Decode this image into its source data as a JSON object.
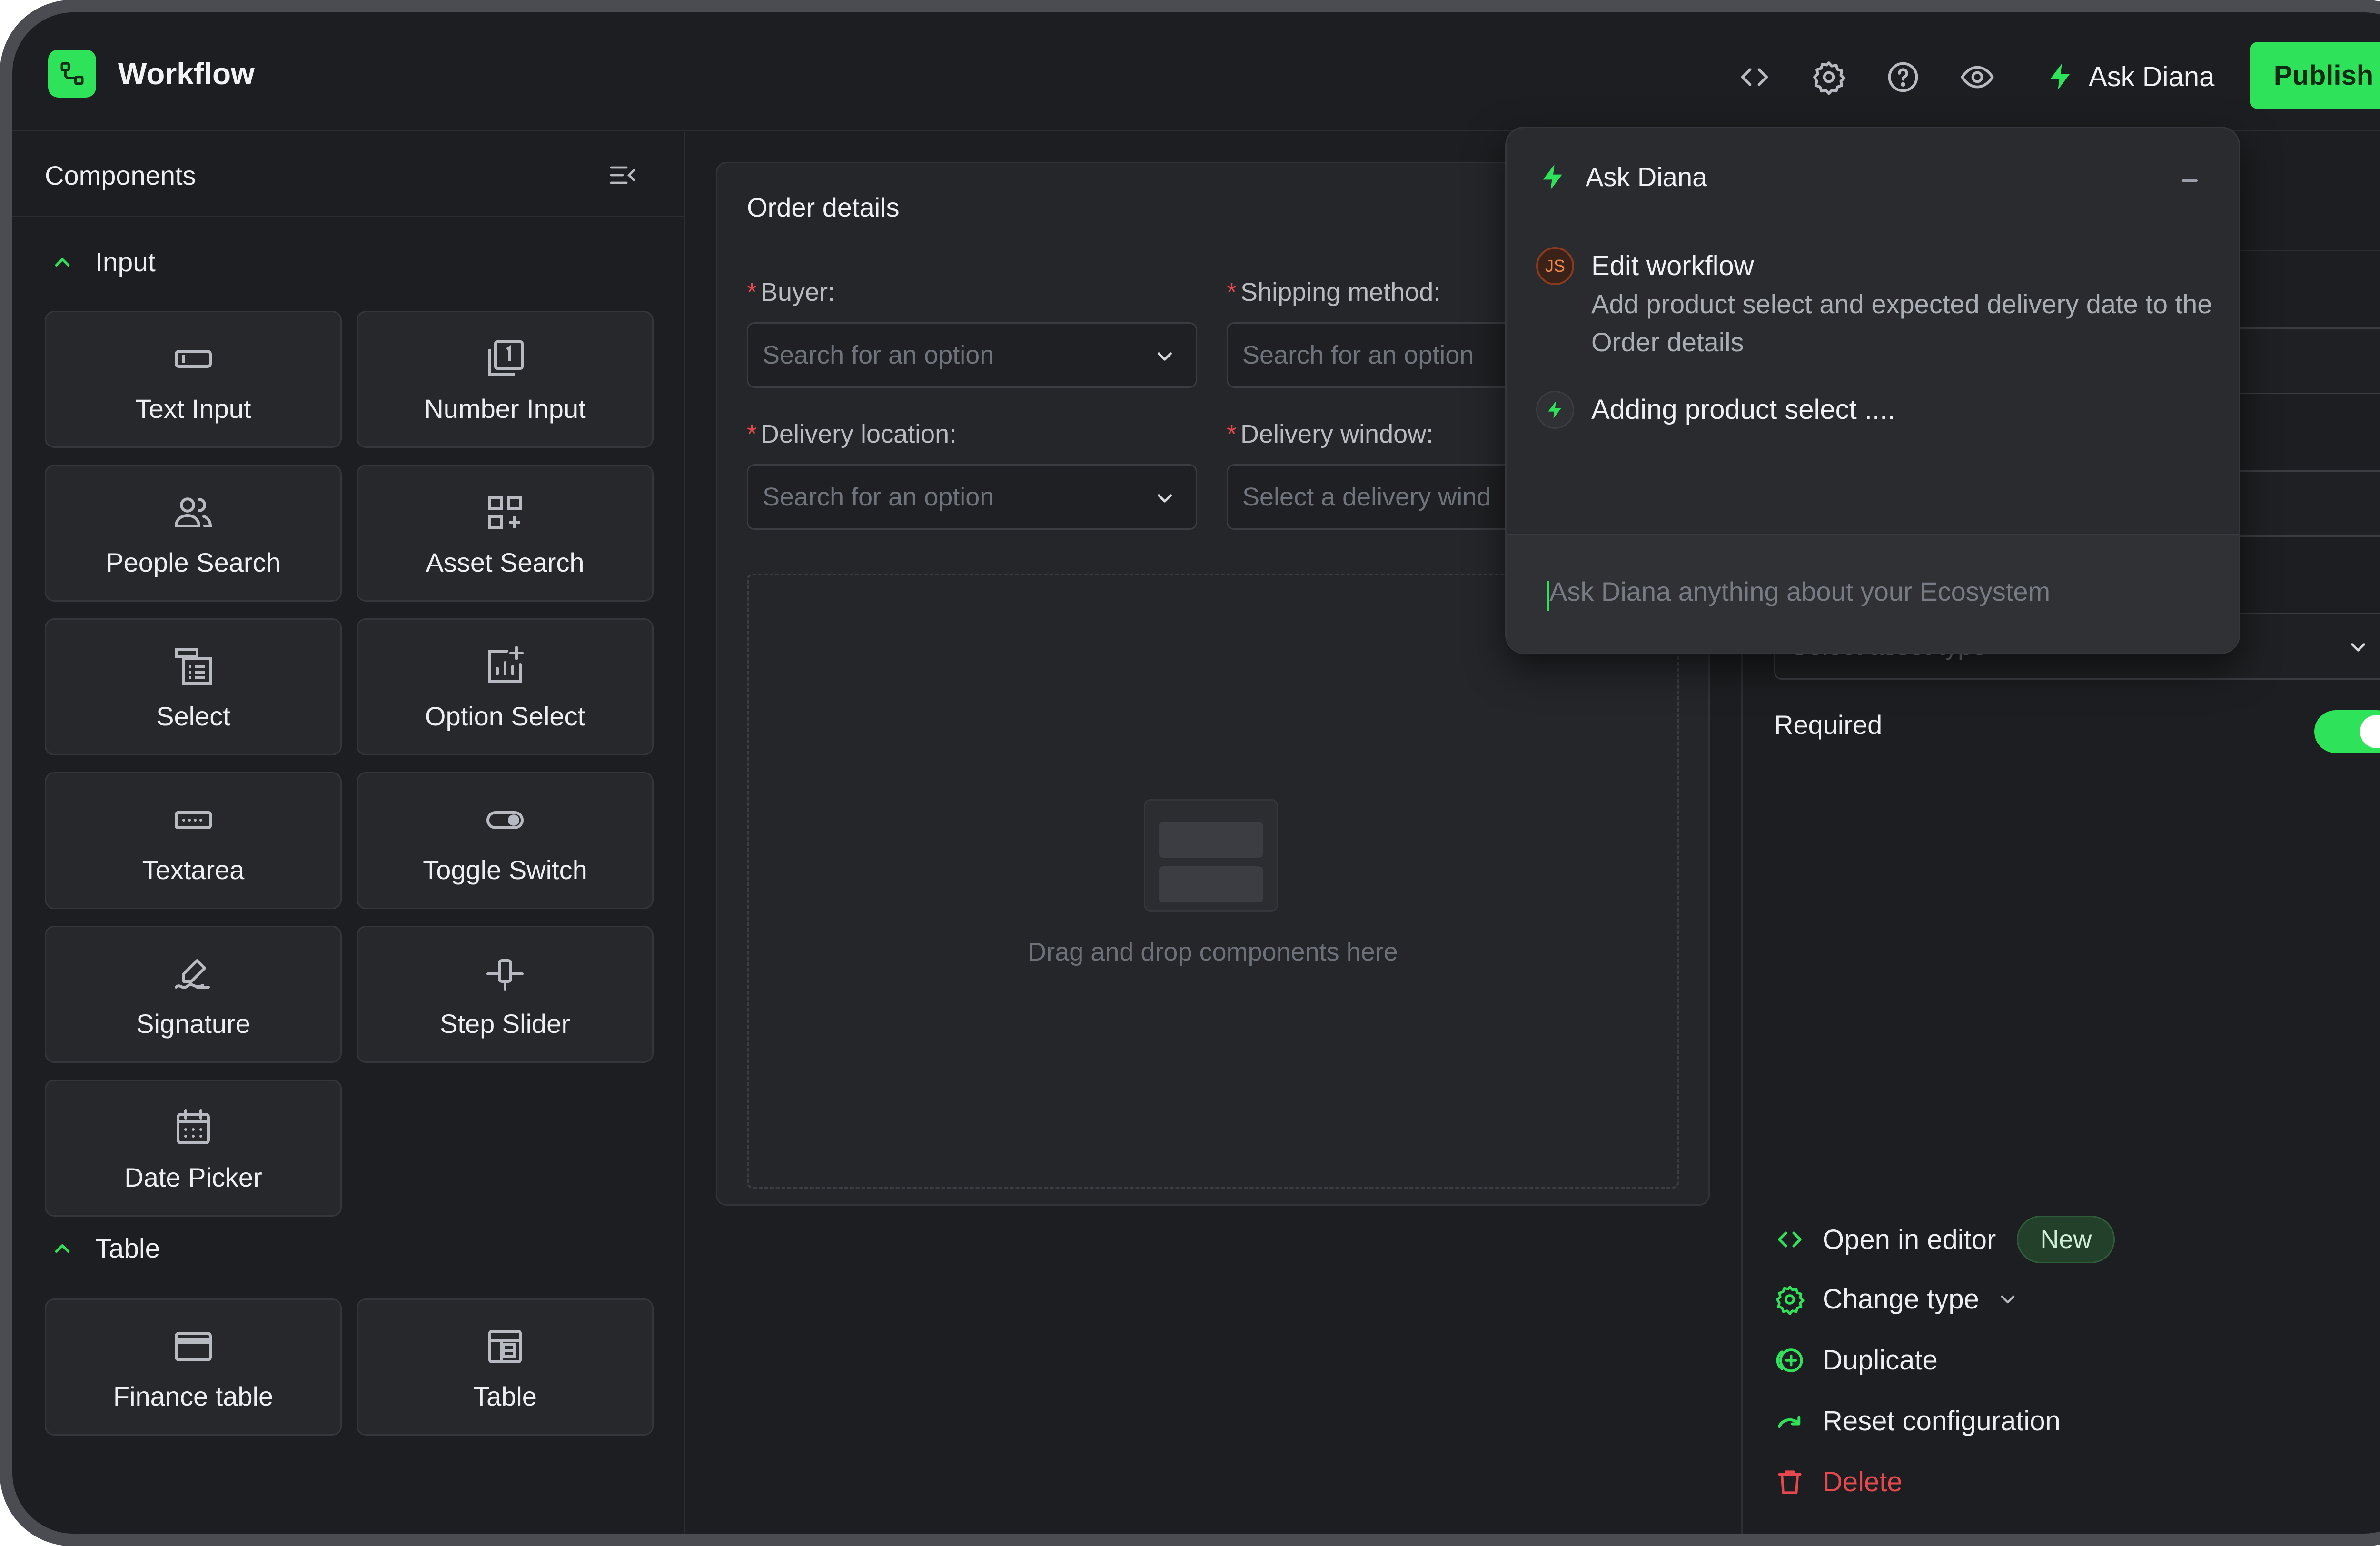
{
  "app": {
    "title": "Workflow",
    "accent_color": "#2ee35a",
    "header_icons": [
      "code-icon",
      "gear-icon",
      "help-icon",
      "eye-icon"
    ],
    "ask_label": "Ask Diana",
    "publish_label": "Publish"
  },
  "sidebar": {
    "title": "Components",
    "sections": [
      {
        "label": "Input",
        "items": [
          {
            "label": "Text Input",
            "icon": "text-input-icon"
          },
          {
            "label": "Number Input",
            "icon": "number-input-icon"
          },
          {
            "label": "People Search",
            "icon": "people-icon"
          },
          {
            "label": "Asset Search",
            "icon": "asset-search-icon"
          },
          {
            "label": "Select",
            "icon": "select-icon"
          },
          {
            "label": "Option Select",
            "icon": "option-select-icon"
          },
          {
            "label": "Textarea",
            "icon": "textarea-icon"
          },
          {
            "label": "Toggle Switch",
            "icon": "toggle-icon"
          },
          {
            "label": "Signature",
            "icon": "signature-icon"
          },
          {
            "label": "Step Slider",
            "icon": "slider-icon"
          },
          {
            "label": "Date Picker",
            "icon": "calendar-icon"
          }
        ]
      },
      {
        "label": "Table",
        "items": [
          {
            "label": "Finance table",
            "icon": "finance-table-icon"
          },
          {
            "label": "Table",
            "icon": "table-icon"
          }
        ]
      }
    ]
  },
  "canvas": {
    "title": "Order details",
    "fields": [
      {
        "label": "Buyer:",
        "required": "*",
        "placeholder": "Search for an option"
      },
      {
        "label": "Shipping method:",
        "required": "*",
        "placeholder": "Search for an option"
      },
      {
        "label": "Delivery location:",
        "required": "*",
        "placeholder": "Search for an option"
      },
      {
        "label": "Delivery window:",
        "required": "*",
        "placeholder": "Select a delivery wind"
      }
    ],
    "dropzone_text": "Drag and drop components here"
  },
  "properties": {
    "asset_type_placeholder": "Select asset type",
    "required_label": "Required",
    "required_on": true,
    "actions": [
      {
        "label": "Open in editor",
        "icon": "code-icon",
        "badge": "New"
      },
      {
        "label": "Change type",
        "icon": "gear-icon"
      },
      {
        "label": "Duplicate",
        "icon": "duplicate-icon"
      },
      {
        "label": "Reset configuration",
        "icon": "reset-icon"
      },
      {
        "label": "Delete",
        "icon": "trash-icon"
      }
    ]
  },
  "ask_diana": {
    "title": "Ask Diana",
    "user_initials": "JS",
    "user_message_title": "Edit workflow",
    "user_message_body": "Add product select and expected delivery date to the Order details",
    "assistant_status": "Adding product select ....",
    "input_placeholder": "Ask Diana anything about your Ecosystem"
  }
}
